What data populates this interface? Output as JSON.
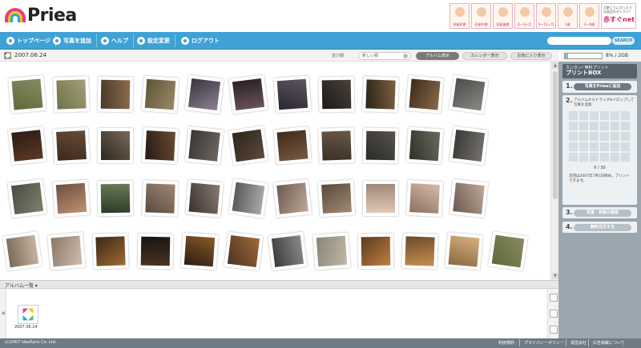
{
  "header": {
    "logo_text": "Priea",
    "promo": {
      "tiles": [
        "妊娠初期",
        "妊娠中期",
        "妊娠後期",
        "0～3ヶ月",
        "4～11ヶ月",
        "1歳",
        "2～6歳"
      ],
      "banner_text": "月齢ごとにぴったりな商品をセレクト!",
      "banner_brand": "赤すぐnet"
    }
  },
  "nav": {
    "items": [
      "トップページ",
      "写真を追加",
      "ヘルプ",
      "設定変更",
      "ログアウト"
    ],
    "search_button": "SEARCH"
  },
  "subbar": {
    "album_date": "2007.06.24",
    "sort_label": "並び順",
    "sort_value": "新しい順",
    "tabs": [
      "アルバム表示",
      "カレンダー表示",
      "お気に入り表示"
    ],
    "storage_text": "8% / 2GB",
    "storage_fraction": 0.08
  },
  "album_bar": {
    "label": "アルバム一覧",
    "album_thumb_label": "2007.06.24"
  },
  "right_panel": {
    "head_line1": "カンタン! 無料プリント",
    "head_line2": "プリントBOX",
    "step1_num": "1.",
    "step1_btn": "写真をPrieaに追加",
    "step2_num": "2.",
    "step2_text": "アルバムからドラッグ&ドロップして写真を追加",
    "count": "0 / 30",
    "note": "次回は2007年7月1日締め。プリントできます。",
    "step3_num": "3.",
    "step3_btn": "写真・枚数の確認",
    "step4_num": "4.",
    "step4_btn": "無料注文する"
  },
  "footer": {
    "copyright": "(c)2007 ideaSync Co. Ltd.",
    "links": [
      "利用規約",
      "プライバシーポリシー",
      "運営会社",
      "広告掲載について"
    ]
  },
  "colors": {
    "nav": "#3ea2d6",
    "panel": "#9aa7b1",
    "footer": "#6e7b85"
  }
}
